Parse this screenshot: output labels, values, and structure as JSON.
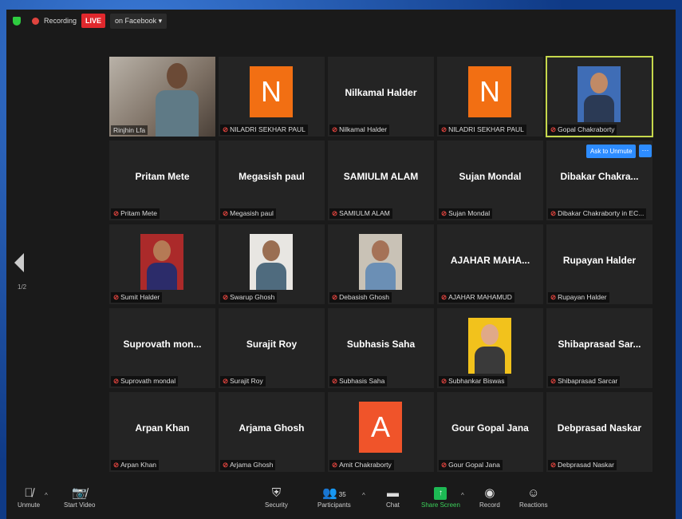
{
  "topbar": {
    "recording": "Recording",
    "live": "LIVE",
    "on_facebook": "on Facebook ▾"
  },
  "tiles": [
    {
      "kind": "video",
      "label": "Rinjhin Lfa",
      "name": ""
    },
    {
      "kind": "avatar",
      "letter": "N",
      "avatar_color": "#f26f13",
      "label": "NILADRI SEKHAR PAUL"
    },
    {
      "kind": "name",
      "name": "Nilkamal Halder",
      "label": "Nilkamal Halder"
    },
    {
      "kind": "avatar",
      "letter": "N",
      "avatar_color": "#f26f13",
      "label": "NILADRI SEKHAR PAUL"
    },
    {
      "kind": "photo",
      "label": "Gopal Chakraborty",
      "active": true
    },
    {
      "kind": "name",
      "name": "Pritam Mete",
      "label": "Pritam Mete"
    },
    {
      "kind": "name",
      "name": "Megasish paul",
      "label": "Megasish paul"
    },
    {
      "kind": "name",
      "name": "SAMIULM ALAM",
      "label": "SAMIULM ALAM"
    },
    {
      "kind": "name",
      "name": "Sujan Mondal",
      "label": "Sujan Mondal"
    },
    {
      "kind": "name",
      "name": "Dibakar Chakra...",
      "label": "Dibakar Chakraborty in EC..."
    },
    {
      "kind": "photo",
      "label": "Sumit Halder"
    },
    {
      "kind": "photo",
      "label": "Swarup Ghosh"
    },
    {
      "kind": "photo",
      "label": "Debasish Ghosh"
    },
    {
      "kind": "name",
      "name": "AJAHAR MAHA...",
      "label": "AJAHAR MAHAMUD"
    },
    {
      "kind": "name",
      "name": "Rupayan Halder",
      "label": "Rupayan Halder"
    },
    {
      "kind": "name",
      "name": "Suprovath mon...",
      "label": "Suprovath mondal"
    },
    {
      "kind": "name",
      "name": "Surajit Roy",
      "label": "Surajit Roy"
    },
    {
      "kind": "name",
      "name": "Subhasis Saha",
      "label": "Subhasis Saha"
    },
    {
      "kind": "photo",
      "label": "Subhankar Biswas"
    },
    {
      "kind": "name",
      "name": "Shibaprasad Sar...",
      "label": "Shibaprasad Sarcar"
    },
    {
      "kind": "name",
      "name": "Arpan Khan",
      "label": "Arpan Khan"
    },
    {
      "kind": "name",
      "name": "Arjama Ghosh",
      "label": "Arjama Ghosh"
    },
    {
      "kind": "avatar",
      "letter": "A",
      "avatar_color": "#f0542a",
      "label": "Amit Chakraborty"
    },
    {
      "kind": "name",
      "name": "Gour Gopal Jana",
      "label": "Gour Gopal Jana"
    },
    {
      "kind": "name",
      "name": "Debprasad Naskar",
      "label": "Debprasad Naskar"
    }
  ],
  "ask_to_unmute": "Ask to Unmute",
  "more": "···",
  "page_indicator": "1/2",
  "toolbar": {
    "unmute": "Unmute",
    "start_video": "Start Video",
    "security": "Security",
    "participants": "Participants",
    "participants_count": "35",
    "chat": "Chat",
    "share_screen": "Share Screen",
    "record": "Record",
    "reactions": "Reactions"
  }
}
